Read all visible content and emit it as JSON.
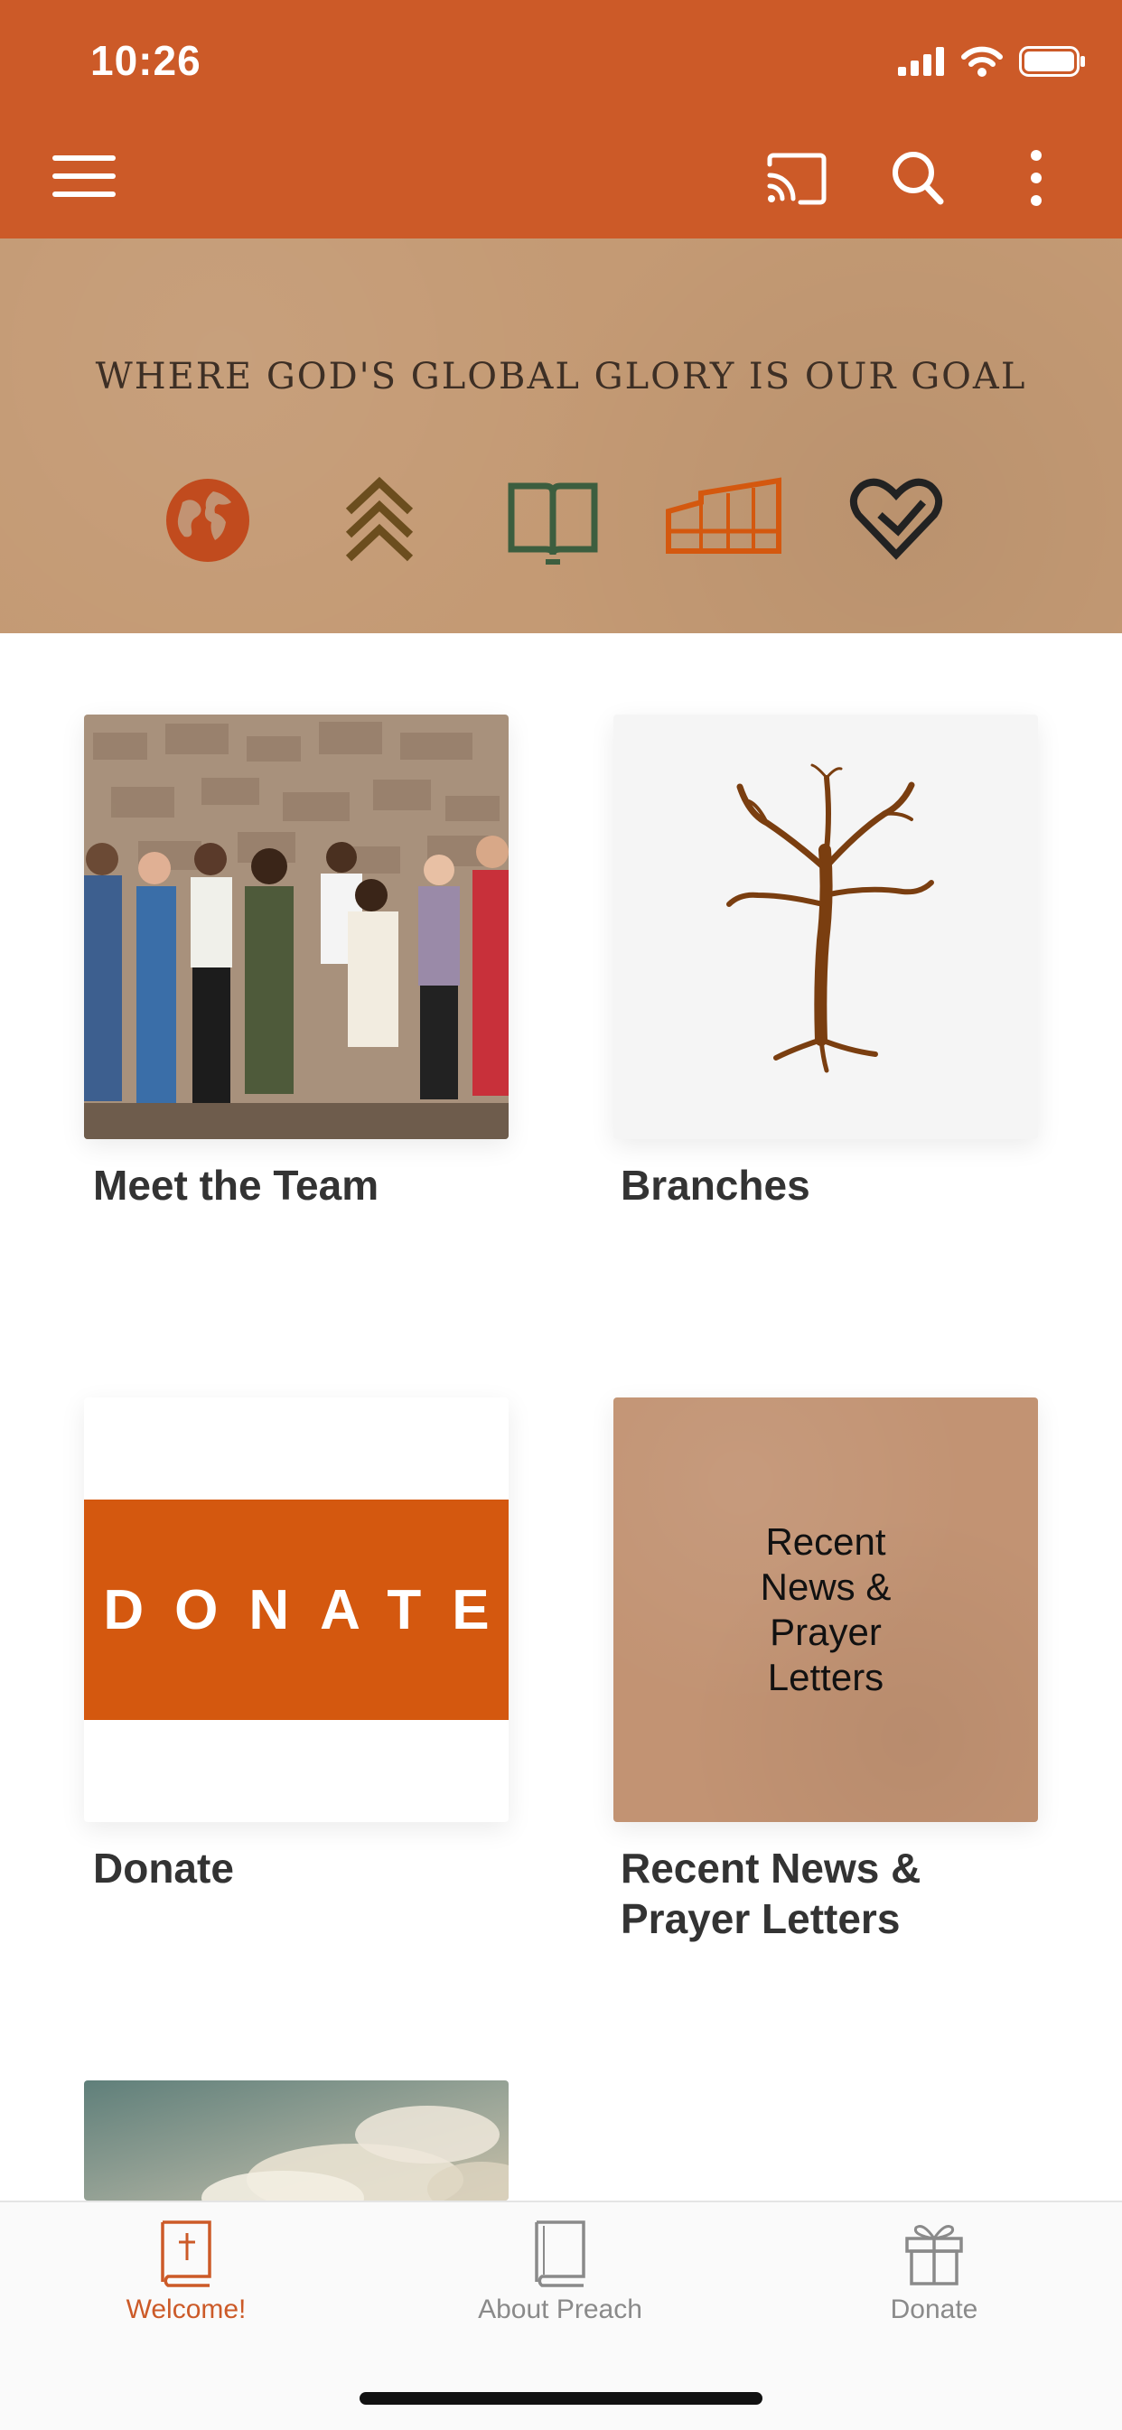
{
  "status_bar": {
    "time": "10:26"
  },
  "banner": {
    "tagline": "WHERE GOD'S GLOBAL GLORY IS OUR GOAL",
    "icons": [
      "globe-icon",
      "chevrons-up-icon",
      "open-book-icon",
      "building-icon",
      "heart-icon"
    ]
  },
  "tiles": [
    {
      "label": "Meet the Team",
      "image": "team-photo"
    },
    {
      "label": "Branches",
      "image": "tree-icon"
    },
    {
      "label": "Donate",
      "image_text": "DONATE"
    },
    {
      "label": "Recent News &\nPrayer Letters",
      "image_text": "Recent\nNews &\nPrayer\nLetters"
    }
  ],
  "tabs": [
    {
      "label": "Welcome!",
      "icon": "bible-icon",
      "active": true
    },
    {
      "label": "About Preach",
      "icon": "book-icon",
      "active": false
    },
    {
      "label": "Donate",
      "icon": "gift-icon",
      "active": false
    }
  ],
  "colors": {
    "brand": "#cc5a28",
    "donate": "#d4580f",
    "kraft": "#c29373"
  }
}
